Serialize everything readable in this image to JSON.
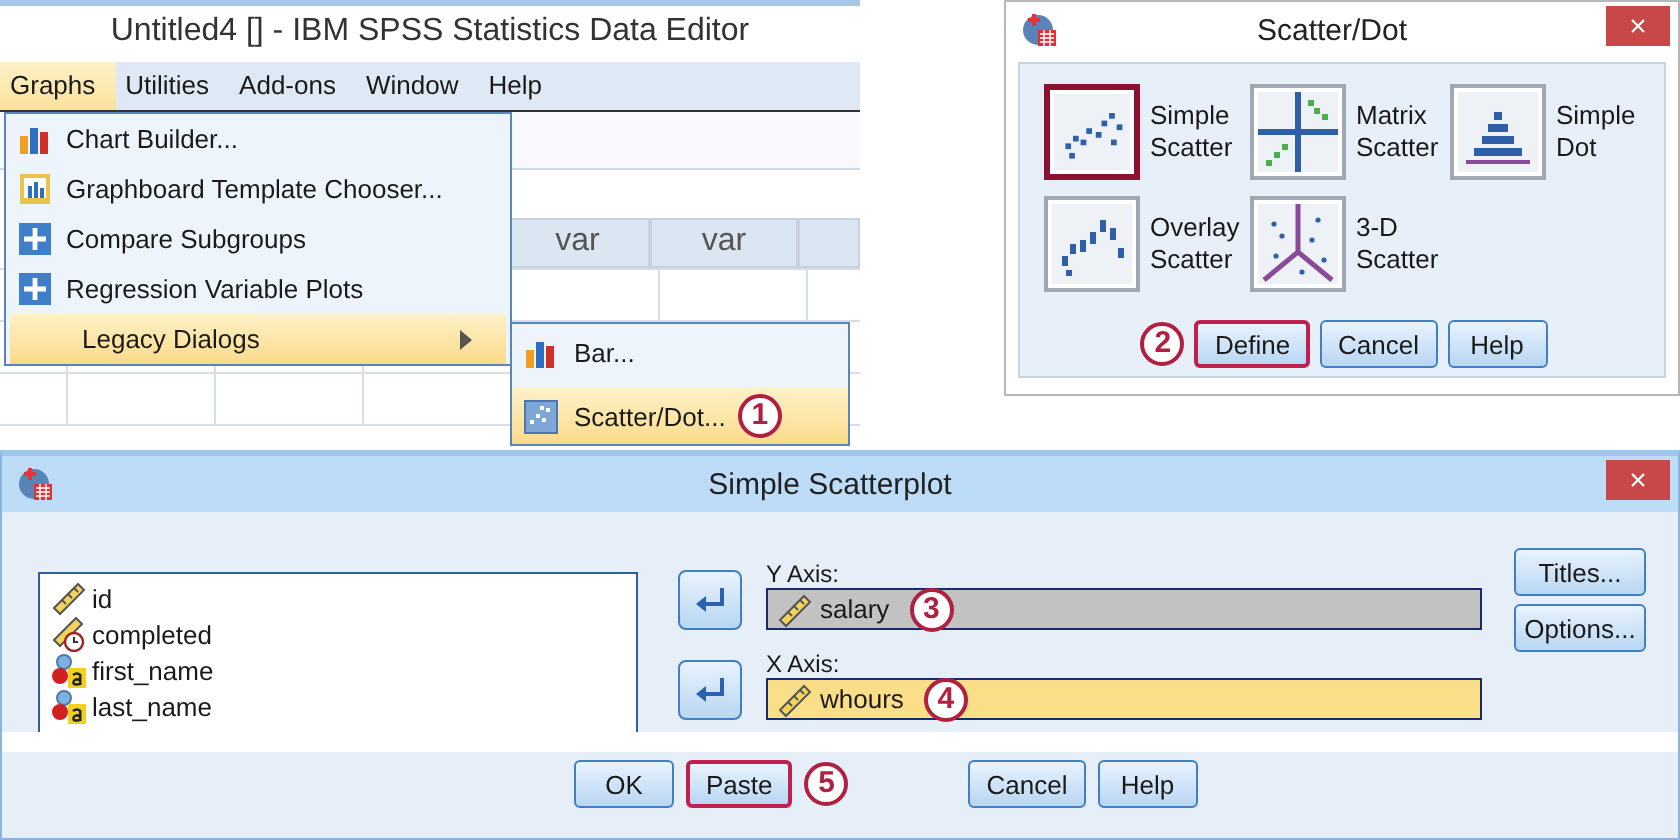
{
  "data_editor": {
    "title": "Untitled4 [] - IBM SPSS Statistics Data Editor",
    "menu": [
      {
        "label": "Graphs",
        "selected": true
      },
      {
        "label": "Utilities",
        "selected": false
      },
      {
        "label": "Add-ons",
        "selected": false
      },
      {
        "label": "Window",
        "selected": false
      },
      {
        "label": "Help",
        "selected": false
      }
    ],
    "graphs_menu": [
      {
        "label": "Chart Builder...",
        "kind": "bars",
        "selected": false,
        "submenu": false
      },
      {
        "label": "Graphboard Template Chooser...",
        "kind": "board",
        "selected": false,
        "submenu": false
      },
      {
        "label": "Compare Subgroups",
        "kind": "plus",
        "selected": false,
        "submenu": false
      },
      {
        "label": "Regression Variable Plots",
        "kind": "plus",
        "selected": false,
        "submenu": false
      },
      {
        "label": "Legacy Dialogs",
        "kind": "none",
        "selected": true,
        "submenu": true
      }
    ],
    "legacy_menu": [
      {
        "label": "Bar...",
        "kind": "bars",
        "selected": false
      },
      {
        "label": "Scatter/Dot...",
        "kind": "scatter",
        "selected": true,
        "step": "1"
      }
    ],
    "grid_columns": [
      "var",
      "var"
    ]
  },
  "scatter_dot_dialog": {
    "title": "Scatter/Dot",
    "close": "×",
    "chart_types": [
      {
        "label": "Simple Scatter",
        "kind": "simple",
        "selected": true
      },
      {
        "label": "Matrix Scatter",
        "kind": "matrix",
        "selected": false
      },
      {
        "label": "Simple Dot",
        "kind": "dot",
        "selected": false
      },
      {
        "label": "Overlay Scatter",
        "kind": "overlay",
        "selected": false
      },
      {
        "label": "3-D Scatter",
        "kind": "three_d",
        "selected": false
      }
    ],
    "buttons": [
      {
        "label": "Define",
        "highlighted": true,
        "step": "2"
      },
      {
        "label": "Cancel",
        "highlighted": false
      },
      {
        "label": "Help",
        "highlighted": false
      }
    ]
  },
  "scatterplot_dialog": {
    "title": "Simple Scatterplot",
    "close": "×",
    "variables": [
      {
        "name": "id",
        "kind": "scale"
      },
      {
        "name": "completed",
        "kind": "scale_time"
      },
      {
        "name": "first_name",
        "kind": "nominal_string"
      },
      {
        "name": "last_name",
        "kind": "nominal_string"
      }
    ],
    "axes": [
      {
        "label": "Y Axis:",
        "value": "salary",
        "kind": "scale",
        "focused": false,
        "step": "3"
      },
      {
        "label": "X Axis:",
        "value": "whours",
        "kind": "scale",
        "focused": true,
        "step": "4"
      }
    ],
    "side_buttons": [
      {
        "label": "Titles..."
      },
      {
        "label": "Options..."
      }
    ],
    "buttons": [
      {
        "label": "OK",
        "highlighted": false
      },
      {
        "label": "Paste",
        "highlighted": true,
        "step": "5"
      },
      {
        "label": "Cancel",
        "highlighted": false
      },
      {
        "label": "Help",
        "highlighted": false
      }
    ]
  }
}
